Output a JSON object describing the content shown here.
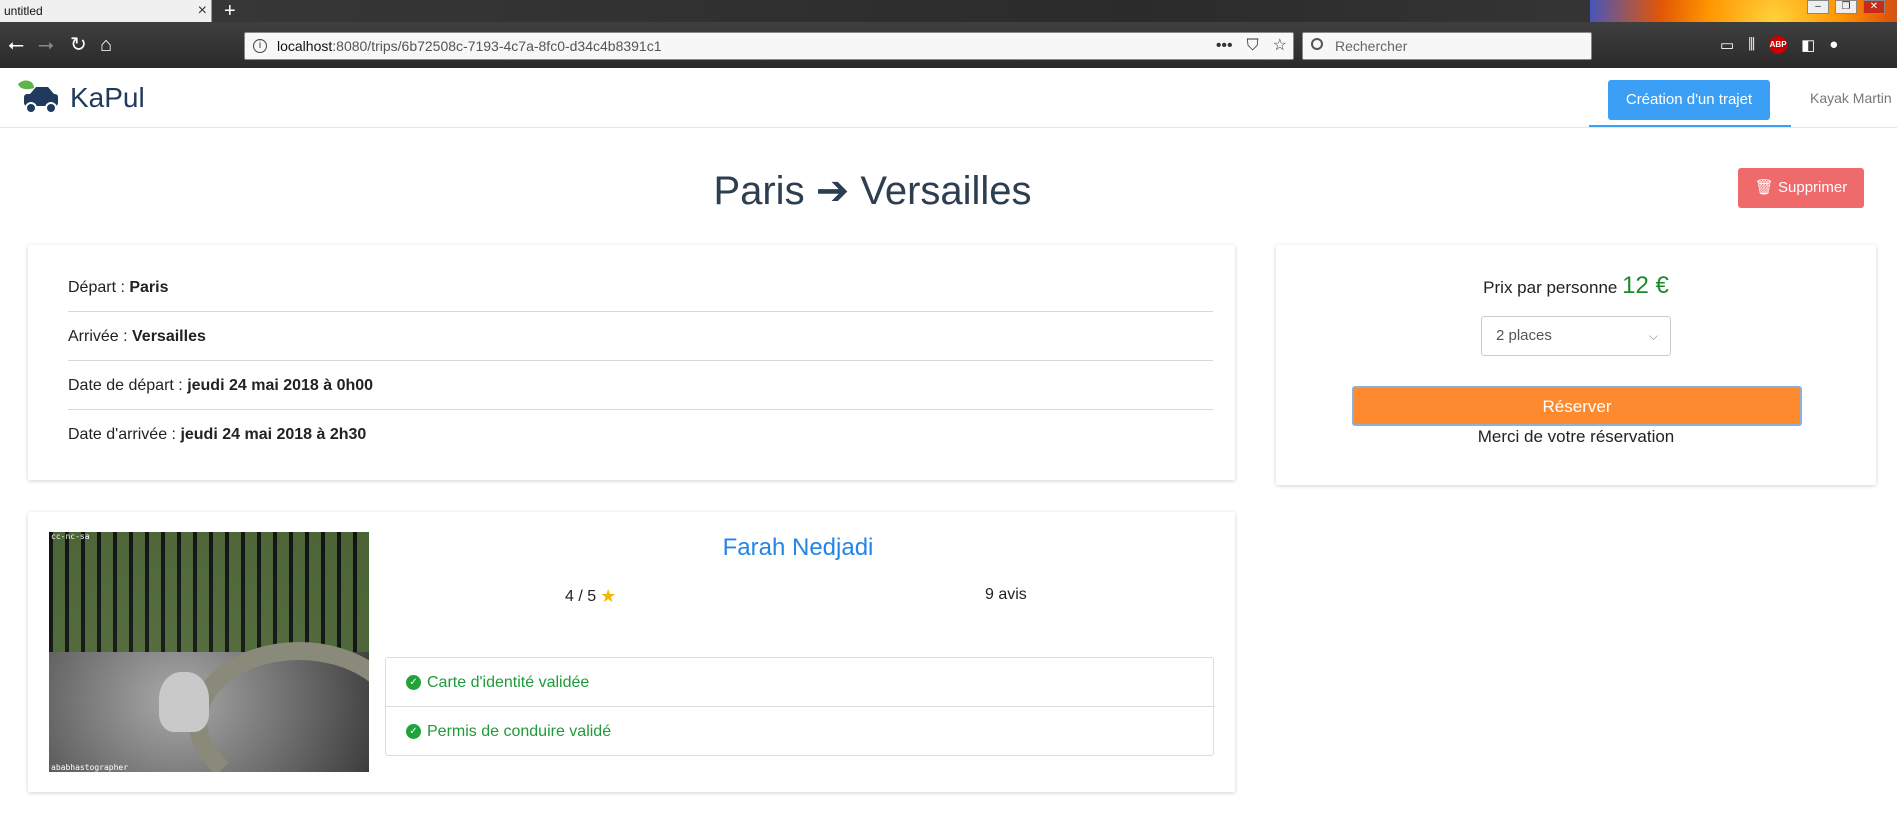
{
  "browser": {
    "tab_title": "untitled",
    "tab_close": "×",
    "new_tab": "+",
    "url_host": "localhost",
    "url_path": ":8080/trips/6b72508c-7193-4c7a-8fc0-d34c4b8391c1",
    "search_placeholder": "Rechercher",
    "url_more": "•••",
    "window_buttons": {
      "minimize": "–",
      "restore": "❐",
      "close": "✕"
    },
    "abp_label": "ABP"
  },
  "app": {
    "brand": "KaPul",
    "create_trip_label": "Création d'un trajet",
    "user_name": "Kayak Martin"
  },
  "trip": {
    "from": "Paris",
    "arrow": "➔",
    "to": "Versailles",
    "delete_label": "Supprimer",
    "details": [
      {
        "label": "Départ : ",
        "value": "Paris"
      },
      {
        "label": "Arrivée : ",
        "value": "Versailles"
      },
      {
        "label": "Date de départ : ",
        "value": "jeudi 24 mai 2018 à 0h00"
      },
      {
        "label": "Date d'arrivée : ",
        "value": "jeudi 24 mai 2018 à 2h30"
      }
    ]
  },
  "booking": {
    "price_label": "Prix par personne",
    "price_value": "12 €",
    "seats_selected": "2 places",
    "reserve_label": "Réserver",
    "thanks_message": "Merci de votre réservation"
  },
  "driver": {
    "name": "Farah Nedjadi",
    "rating": "4 / 5",
    "reviews": "9 avis",
    "photo_tag_top": "cc-nc-sa",
    "photo_tag_bottom": "ababhastographer",
    "verifications": [
      "Carte d'identité validée",
      "Permis de conduire validé"
    ]
  },
  "colors": {
    "accent_blue": "#3ba0f5",
    "delete_red": "#ef6a6a",
    "reserve_orange": "#fd8a2e",
    "price_green": "#1a8a2a",
    "verified_green": "#1f9a3a",
    "driver_name_blue": "#2385e8"
  },
  "icons": [
    "back-icon",
    "forward-icon",
    "reload-icon",
    "home-icon",
    "info-icon",
    "pocket-icon",
    "bookmark-star-icon",
    "search-icon",
    "library-icon",
    "sidebar-icon",
    "trash-icon",
    "star-icon",
    "check-circle-icon",
    "chevron-down-icon",
    "car-logo-icon"
  ]
}
